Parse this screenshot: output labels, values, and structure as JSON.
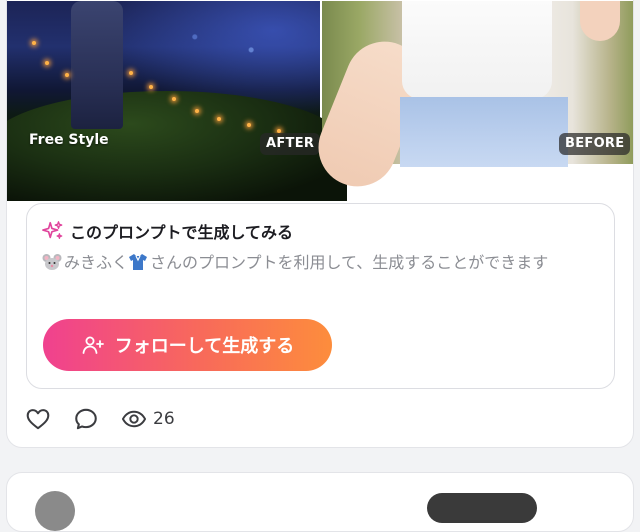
{
  "images": {
    "left_label": "Free Style",
    "after_badge": "AFTER",
    "before_badge": "BEFORE"
  },
  "prompt": {
    "title": "このプロンプトで生成してみる",
    "desc_author": "みきふく",
    "desc_text": "さんのプロンプトを利用して、生成することができます",
    "cta_label": "フォローして生成する"
  },
  "stats": {
    "views": "26"
  },
  "colors": {
    "cta_gradient": [
      "#f0418f",
      "#fd8d3c"
    ],
    "sparkle": "#e0449c"
  }
}
